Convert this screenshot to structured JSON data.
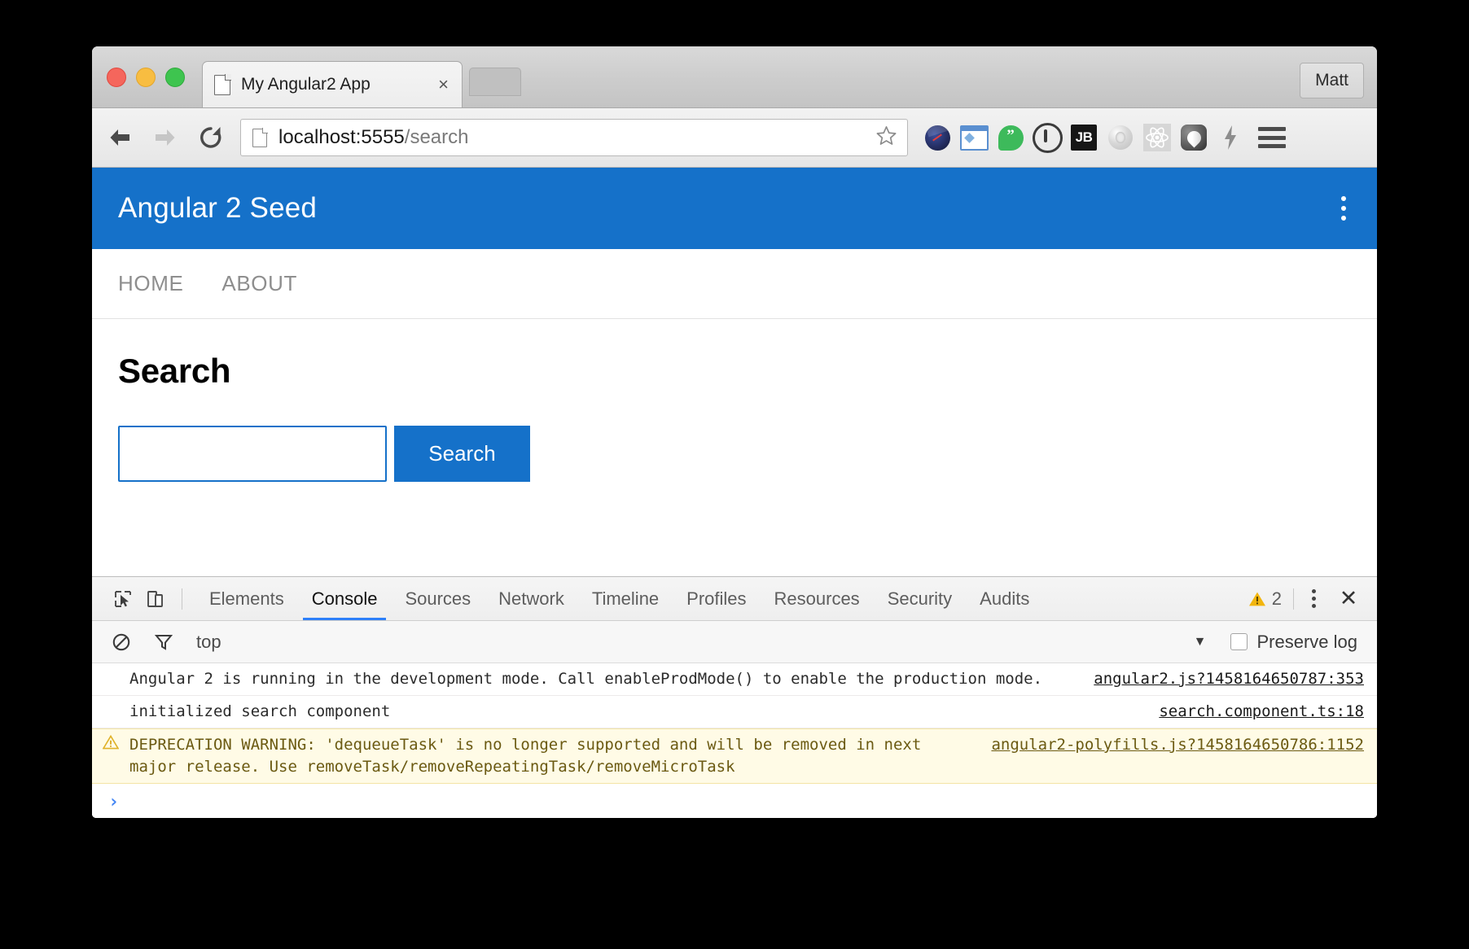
{
  "browser": {
    "profile_label": "Matt",
    "tab": {
      "title": "My Angular2 App",
      "favicon": "page-icon",
      "close": "×"
    },
    "omnibox": {
      "host": "localhost:5555",
      "path": "/search",
      "full_url": "localhost:5555/search",
      "star": "bookmark-star-icon"
    },
    "nav": {
      "back": "back-arrow-icon",
      "forward": "forward-arrow-icon",
      "reload": "reload-icon"
    },
    "extensions": [
      {
        "name": "speedometer-extension-icon",
        "label": ""
      },
      {
        "name": "window-resizer-extension-icon",
        "label": ""
      },
      {
        "name": "hangouts-extension-icon",
        "label": "”"
      },
      {
        "name": "keypass-extension-icon",
        "label": ""
      },
      {
        "name": "jetbrains-extension-icon",
        "label": "JB"
      },
      {
        "name": "ring-extension-icon",
        "label": ""
      },
      {
        "name": "react-devtools-extension-icon",
        "label": ""
      },
      {
        "name": "octopus-extension-icon",
        "label": ""
      },
      {
        "name": "lightning-extension-icon",
        "label": "⚡"
      }
    ],
    "menu": "chrome-menu-icon"
  },
  "app": {
    "header_title": "Angular 2 Seed",
    "header_color": "#1571c9",
    "kebab": "overflow-menu-icon",
    "nav": [
      {
        "label": "HOME"
      },
      {
        "label": "ABOUT"
      }
    ],
    "page_title": "Search",
    "search": {
      "input_value": "",
      "input_placeholder": "",
      "button_label": "Search"
    }
  },
  "devtools": {
    "inspect_icon": "inspect-element-icon",
    "device_icon": "device-toolbar-icon",
    "tabs": [
      {
        "label": "Elements",
        "active": false
      },
      {
        "label": "Console",
        "active": true
      },
      {
        "label": "Sources",
        "active": false
      },
      {
        "label": "Network",
        "active": false
      },
      {
        "label": "Timeline",
        "active": false
      },
      {
        "label": "Profiles",
        "active": false
      },
      {
        "label": "Resources",
        "active": false
      },
      {
        "label": "Security",
        "active": false
      },
      {
        "label": "Audits",
        "active": false
      }
    ],
    "warning_count": "2",
    "warning_icon": "warning-triangle-icon",
    "more_icon": "more-options-icon",
    "close_icon": "close-devtools-icon",
    "filterbar": {
      "clear_icon": "clear-console-icon",
      "filter_icon": "filter-funnel-icon",
      "context": "top",
      "caret": "▼",
      "preserve_log_label": "Preserve log",
      "preserve_log_checked": false
    },
    "console": {
      "messages": [
        {
          "level": "log",
          "text": "Angular 2 is running in the development mode. Call enableProdMode() to enable the production mode.",
          "source": "angular2.js?1458164650787:353"
        },
        {
          "level": "log",
          "text": "initialized search component",
          "source": "search.component.ts:18"
        },
        {
          "level": "warning",
          "text": "DEPRECATION WARNING: 'dequeueTask' is no longer supported and will be removed in next major release. Use removeTask/removeRepeatingTask/removeMicroTask",
          "source": "angular2-polyfills.js?1458164650786:1152"
        }
      ],
      "prompt_caret": "›"
    }
  }
}
